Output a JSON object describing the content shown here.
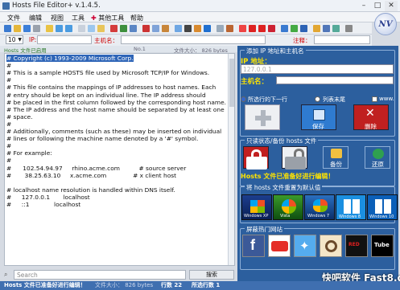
{
  "window": {
    "title": "Hosts File Editor+ v.1.4.5."
  },
  "menu": [
    "文件",
    "编辑",
    "视图",
    "工具",
    "其他工具",
    "帮助"
  ],
  "logo_text": "NV",
  "entry_row": {
    "number_value": "10",
    "ip_label": "IP:",
    "host_label": "主机名：",
    "comment_label": "注释："
  },
  "editor_status": {
    "name": "Hosts 文件已启用",
    "col_no": "No.1",
    "size_label": "文件大小： 826 bytes"
  },
  "editor_lines": [
    "# Copyright (c) 1993-2009 Microsoft Corp.",
    "#",
    "# This is a sample HOSTS file used by Microsoft TCP/IP for Windows.",
    "#",
    "# This file contains the mappings of IP addresses to host names. Each",
    "# entry should be kept on an individual line. The IP address should",
    "# be placed in the first column followed by the corresponding host name.",
    "# The IP address and the host name should be separated by at least one",
    "# space.",
    "#",
    "# Additionally, comments (such as these) may be inserted on individual",
    "# lines or following the machine name denoted by a '#' symbol.",
    "#",
    "# For example:",
    "#",
    "#      102.54.94.97     rhino.acme.com          # source server",
    "#       38.25.63.10     x.acme.com              # x client host",
    "",
    "# localhost name resolution is handled within DNS itself.",
    "#\t127.0.0.1       localhost",
    "#\t::1             localhost"
  ],
  "search": {
    "placeholder": "Search",
    "button": "搜索"
  },
  "right_panel": {
    "add_section": "添加 IP 地址和主机名",
    "ip_label": "IP 地址：",
    "ip_placeholder": "127.0.0.1",
    "host_label": "主机名：",
    "radio_options": [
      "所选行的下一行",
      "列表末尾",
      "www."
    ],
    "save_label": "保存",
    "delete_label": "删除",
    "backup_section": "只读状态/备份 hosts 文件",
    "backup_label": "备份",
    "restore_label": "还原",
    "notice": "Hosts 文件已准备好进行编辑！",
    "reset_section": "将 hosts 文件重置为默认值",
    "os_buttons": [
      "Windows XP",
      "Vista",
      "Windows 7",
      "Windows 8",
      "Windows 10"
    ],
    "sites_section": "屏蔽热门网站",
    "social_sites": [
      "Facebook",
      "YouTube",
      "Twitter",
      "Instagram",
      "RedTube",
      "Tube"
    ]
  },
  "statusbar": {
    "message": "Hosts 文件已准备好进行编辑！",
    "size": "文件大小： 826 bytes",
    "lines": "行数 22",
    "selected": "所选行数 1"
  },
  "watermark": "快吧软件 Fast8.com",
  "colors": {
    "panel_blue": "#2c5f9e",
    "statusbar_blue": "#3f6fb0",
    "accent_yellow": "#ffe400",
    "delete_red": "#c02020",
    "save_blue": "#2f7bd0",
    "restore_green": "#2fa050"
  }
}
